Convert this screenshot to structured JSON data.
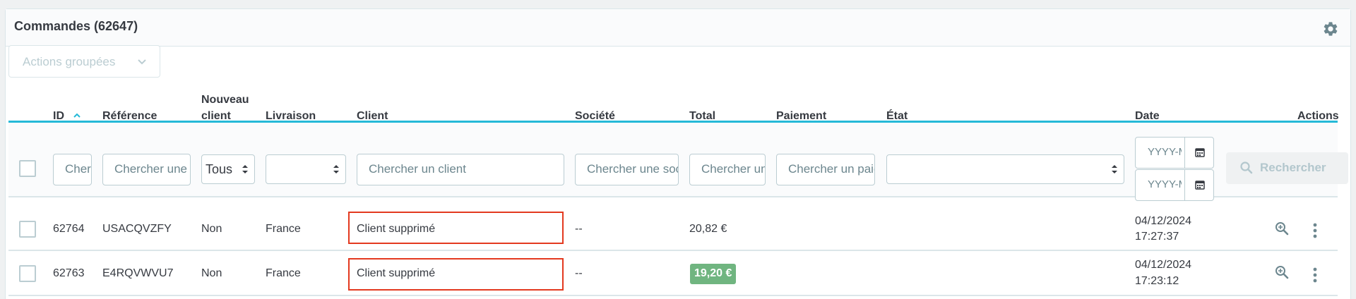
{
  "card": {
    "title": "Commandes (62647)",
    "settings_icon": "gear-icon"
  },
  "bulk_actions": {
    "label": "Actions groupées"
  },
  "columns": {
    "id": "ID",
    "reference": "Référence",
    "new_client_line1": "Nouveau",
    "new_client_line2": "client",
    "delivery": "Livraison",
    "client": "Client",
    "company": "Société",
    "total": "Total",
    "payment": "Paiement",
    "status": "État",
    "date": "Date",
    "actions": "Actions"
  },
  "filters": {
    "id_placeholder": "Chercher un ID",
    "reference_placeholder": "Chercher une référence",
    "new_client_value": "Tous",
    "delivery_value": "",
    "client_placeholder": "Chercher un client",
    "company_placeholder": "Chercher une société",
    "total_placeholder": "Chercher un total",
    "payment_placeholder": "Chercher un paiement",
    "status_value": "",
    "date_from_placeholder": "YYYY-MM-DD",
    "date_to_placeholder": "YYYY-MM-DD",
    "search_label": "Rechercher"
  },
  "rows": [
    {
      "id": "62764",
      "reference": "USACQVZFY",
      "new_client": "Non",
      "delivery": "France",
      "client": "Client supprimé",
      "company": "--",
      "total": "20,82 €",
      "date": "04/12/2024",
      "time": "17:27:37"
    },
    {
      "id": "62763",
      "reference": "E4RQVWVU7",
      "new_client": "Non",
      "delivery": "France",
      "client": "Client supprimé",
      "company": "--",
      "total": "19,20 €",
      "date": "04/12/2024",
      "time": "17:23:12"
    }
  ],
  "colors": {
    "accent": "#25b9d7",
    "highlight": "#e3391f",
    "badge_green": "#70b580"
  }
}
